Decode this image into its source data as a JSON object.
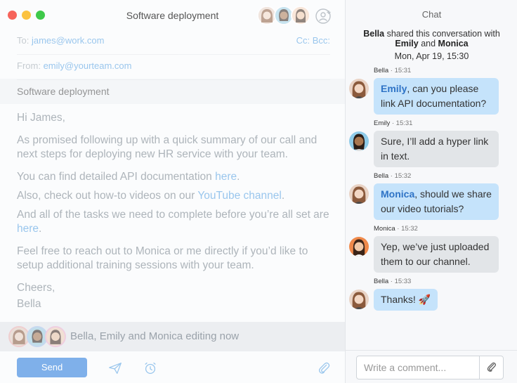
{
  "compose": {
    "window_title": "Software deployment",
    "to_label": "To:",
    "to_value": "james@work.com",
    "cc_bcc": "Cc: Bcc:",
    "from_label": "From:",
    "from_value": "emily@yourteam.com",
    "subject": "Software deployment",
    "body": {
      "greeting": "Hi James,",
      "p1": "As promised following up with a quick summary of our call and next steps for deploying new HR service with your team.",
      "p2_pre": "You can find detailed API documentation ",
      "p2_link": "here",
      "p2_post": ".",
      "p3_pre": "Also, check out how-to videos on our ",
      "p3_link": "YouTube channel",
      "p3_post": ".",
      "p4_pre": "And all of the tasks we need to complete before you’re all set are ",
      "p4_link": "here",
      "p4_post": ".",
      "p5": "Feel free to reach out to Monica or me directly if you’d like to setup additional training sessions with your team.",
      "closing": "Cheers,",
      "signature": "Bella"
    },
    "editing_text": "Bella, Emily and Monica editing now",
    "send_label": "Send"
  },
  "chat": {
    "title": "Chat",
    "shared_line1_pre": "Bella",
    "shared_line1_post": " shared this conversation with",
    "shared_name1": "Emily",
    "shared_and": " and ",
    "shared_name2": "Monica",
    "shared_date": "Mon, Apr 19, 15:30",
    "messages": [
      {
        "name": "Bella",
        "time": " · 15:31",
        "mention": "Emily",
        "text": ", can you please link API documentation?"
      },
      {
        "name": "Emily",
        "time": " · 15:31",
        "text": "Sure, I’ll add a hyper link in text."
      },
      {
        "name": "Bella",
        "time": " · 15:32",
        "mention": "Monica",
        "text": ", should we share our video tutorials?"
      },
      {
        "name": "Monica",
        "time": " · 15:32",
        "text": "Yep, we’ve just uploaded them to our channel."
      },
      {
        "name": "Bella",
        "time": " · 15:33",
        "text": "Thanks! 🚀"
      }
    ],
    "comment_placeholder": "Write a comment..."
  },
  "colors": {
    "accent": "#4a9ae0",
    "bubble_blue": "#c5e3fb",
    "bubble_gray": "#e2e5e8",
    "mention": "#2e73c6",
    "send_button": "#7fb0ea"
  }
}
